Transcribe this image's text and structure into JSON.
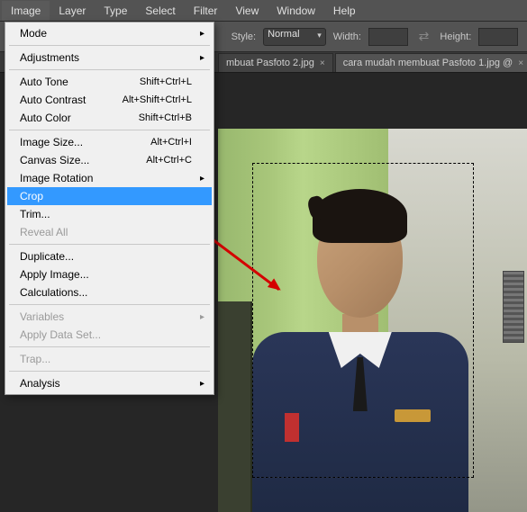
{
  "menubar": [
    "Image",
    "Layer",
    "Type",
    "Select",
    "Filter",
    "View",
    "Window",
    "Help"
  ],
  "menubar_active": 0,
  "optionbar": {
    "style_label": "Style:",
    "style_value": "Normal",
    "width_label": "Width:",
    "height_label": "Height:"
  },
  "tabs": [
    {
      "label": "mbuat Pasfoto 2.jpg",
      "active": false
    },
    {
      "label": "cara mudah membuat Pasfoto 1.jpg @",
      "active": true
    }
  ],
  "dropdown": [
    {
      "label": "Mode",
      "sub": true
    },
    {
      "sep": true
    },
    {
      "label": "Adjustments",
      "sub": true
    },
    {
      "sep": true
    },
    {
      "label": "Auto Tone",
      "shortcut": "Shift+Ctrl+L"
    },
    {
      "label": "Auto Contrast",
      "shortcut": "Alt+Shift+Ctrl+L"
    },
    {
      "label": "Auto Color",
      "shortcut": "Shift+Ctrl+B"
    },
    {
      "sep": true
    },
    {
      "label": "Image Size...",
      "shortcut": "Alt+Ctrl+I"
    },
    {
      "label": "Canvas Size...",
      "shortcut": "Alt+Ctrl+C"
    },
    {
      "label": "Image Rotation",
      "sub": true
    },
    {
      "label": "Crop",
      "highlighted": true
    },
    {
      "label": "Trim..."
    },
    {
      "label": "Reveal All",
      "disabled": true
    },
    {
      "sep": true
    },
    {
      "label": "Duplicate..."
    },
    {
      "label": "Apply Image..."
    },
    {
      "label": "Calculations..."
    },
    {
      "sep": true
    },
    {
      "label": "Variables",
      "sub": true,
      "disabled": true
    },
    {
      "label": "Apply Data Set...",
      "disabled": true
    },
    {
      "sep": true
    },
    {
      "label": "Trap...",
      "disabled": true
    },
    {
      "sep": true
    },
    {
      "label": "Analysis",
      "sub": true
    }
  ]
}
